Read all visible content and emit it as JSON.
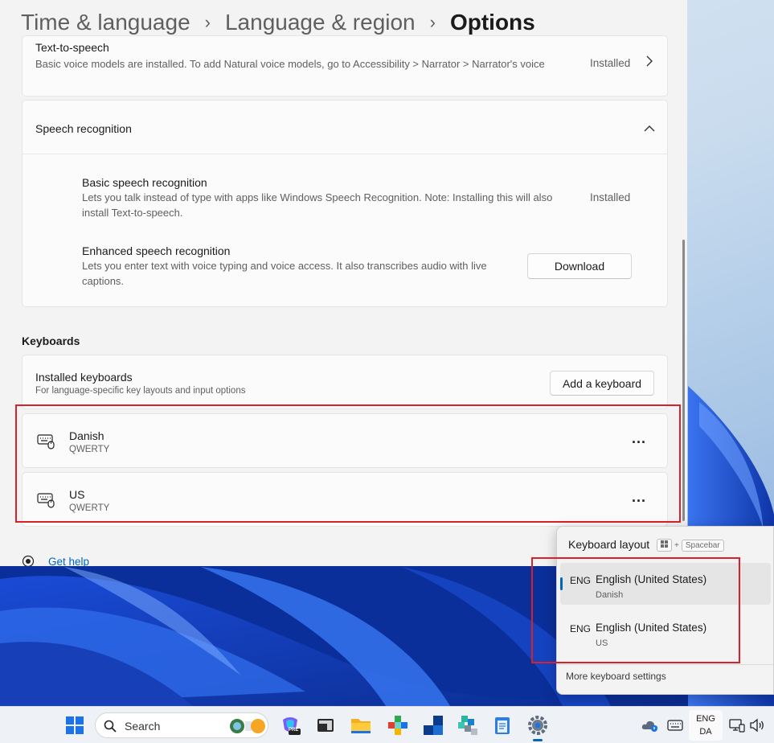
{
  "breadcrumb": {
    "part1": "Time & language",
    "part2": "Language & region",
    "current": "Options",
    "separator": "›"
  },
  "tts": {
    "title": "Text-to-speech",
    "description": "Basic voice models are installed. To add Natural voice models, go to Accessibility > Narrator > Narrator's voice",
    "status": "Installed"
  },
  "speech": {
    "title": "Speech recognition",
    "basic": {
      "title": "Basic speech recognition",
      "description": "Lets you talk instead of type with apps like Windows Speech Recognition. Note: Installing this will also install Text-to-speech.",
      "status": "Installed"
    },
    "enhanced": {
      "title": "Enhanced speech recognition",
      "description": "Lets you enter text with voice typing and voice access. It also transcribes audio with live captions.",
      "button": "Download"
    }
  },
  "keyboards": {
    "section_title": "Keyboards",
    "installed_title": "Installed keyboards",
    "installed_subtitle": "For language-specific key layouts and input options",
    "add_button": "Add a keyboard",
    "items": [
      {
        "name": "Danish",
        "layout": "QWERTY"
      },
      {
        "name": "US",
        "layout": "QWERTY"
      }
    ],
    "more": "..."
  },
  "help": {
    "label": "Get help"
  },
  "flyout": {
    "title": "Keyboard layout",
    "shortcut_plus": "+",
    "shortcut_key": "Spacebar",
    "items": [
      {
        "abbr": "ENG",
        "name": "English (United States)",
        "sub": "Danish",
        "selected": true
      },
      {
        "abbr": "ENG",
        "name": "English (United States)",
        "sub": "US",
        "selected": false
      }
    ],
    "more": "More keyboard settings"
  },
  "taskbar": {
    "search_label": "Search",
    "lang_top": "ENG",
    "lang_bottom": "DA",
    "copilot_badge": "PRE"
  },
  "colors": {
    "accent": "#0067c0",
    "highlight": "#d9212c"
  }
}
